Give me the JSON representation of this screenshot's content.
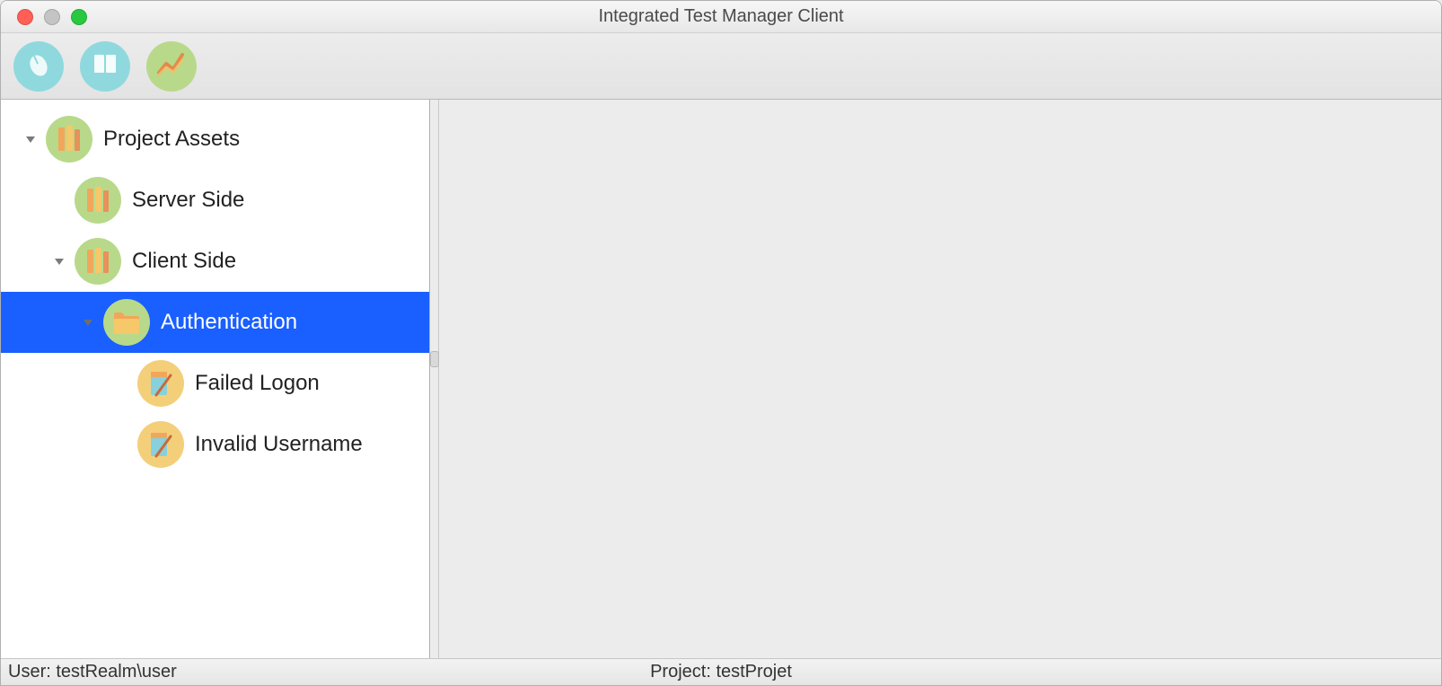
{
  "window": {
    "title": "Integrated Test Manager Client"
  },
  "toolbar": {
    "buttons": [
      {
        "name": "mouse-icon"
      },
      {
        "name": "book-icon"
      },
      {
        "name": "chart-icon"
      }
    ]
  },
  "tree": {
    "root": {
      "label": "Project Assets",
      "icon": "library-icon",
      "expanded": true,
      "children": [
        {
          "label": "Server Side",
          "icon": "library-icon",
          "expanded": false,
          "children": []
        },
        {
          "label": "Client Side",
          "icon": "library-icon",
          "expanded": true,
          "children": [
            {
              "label": "Authentication",
              "icon": "folder-icon",
              "expanded": true,
              "selected": true,
              "children": [
                {
                  "label": "Failed Logon",
                  "icon": "test-icon"
                },
                {
                  "label": "Invalid Username",
                  "icon": "test-icon"
                }
              ]
            }
          ]
        }
      ]
    }
  },
  "statusbar": {
    "user_label": "User: testRealm\\user",
    "project_label": "Project: testProjet"
  }
}
